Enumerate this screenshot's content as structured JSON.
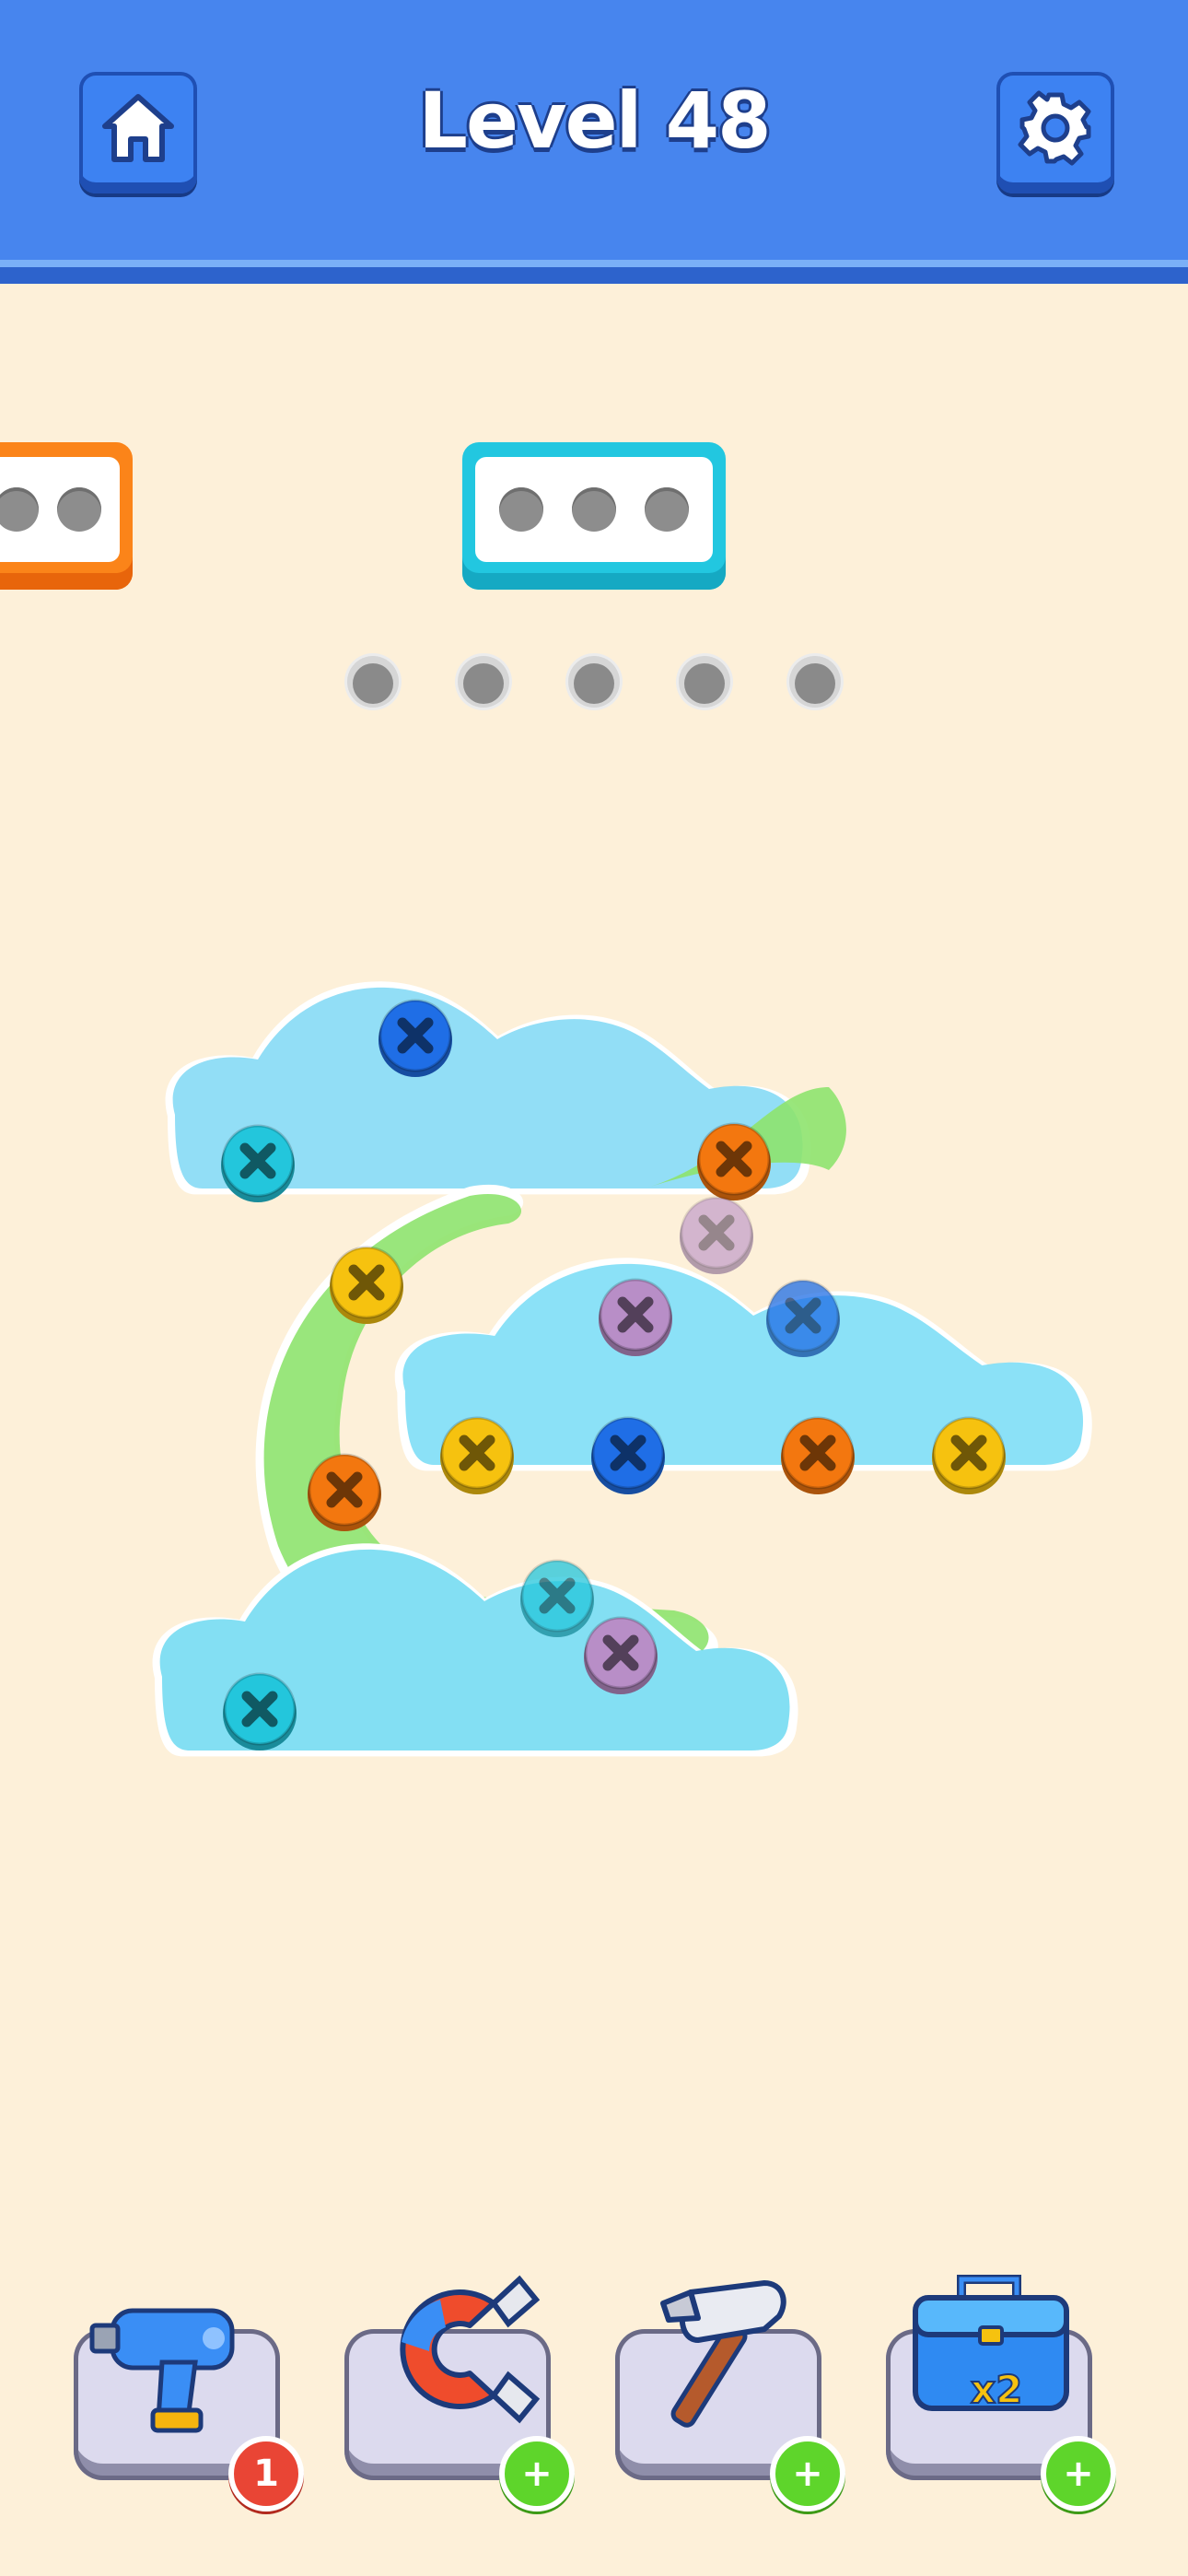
{
  "header": {
    "title": "Level 48",
    "home_icon": "home-icon",
    "settings_icon": "gear-icon"
  },
  "boxes": [
    {
      "color": "#fb8419",
      "slots": 2
    },
    {
      "color": "#22c7e0",
      "slots": 3
    }
  ],
  "hole_count": 5,
  "screw_colors": {
    "cyan": "#23c6dc",
    "blue": "#1f6ee6",
    "orange": "#f3770f",
    "yellow": "#f6c20f",
    "purple": "#b88ec7"
  },
  "tools": [
    {
      "name": "drill",
      "icon": "drill-icon",
      "badge": "1",
      "badge_type": "count"
    },
    {
      "name": "magnet",
      "icon": "magnet-icon",
      "badge": "+",
      "badge_type": "add"
    },
    {
      "name": "hammer",
      "icon": "hammer-icon",
      "badge": "+",
      "badge_type": "add"
    },
    {
      "name": "toolbox",
      "icon": "toolbox-icon",
      "badge": "+",
      "badge_type": "add",
      "label": "x2"
    }
  ]
}
